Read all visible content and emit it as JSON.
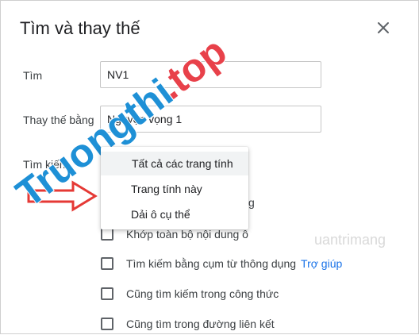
{
  "dialog": {
    "title": "Tìm và thay thế",
    "find_label": "Tìm",
    "find_value": "NV1",
    "replace_label": "Thay thế bằng",
    "replace_value": "Nguyện vọng 1",
    "search_label": "Tìm kiếm"
  },
  "dropdown": {
    "options": [
      "Tất cả các trang tính",
      "Trang tính này",
      "Dải ô cụ thể"
    ],
    "selected": "Tất cả các trang tính"
  },
  "options": {
    "match_case": "g",
    "match_entire": "Khớp toàn bộ nội dung ô",
    "regex": "Tìm kiếm bằng cụm từ thông dụng",
    "help": "Trợ giúp",
    "formulas": "Cũng tìm kiếm trong công thức",
    "links": "Cũng tìm trong đường liên kết"
  },
  "watermark": {
    "text": "Truongthi.top",
    "quantrimang": "uantrimang"
  },
  "colors": {
    "link": "#1a73e8",
    "watermark_blue": "#1e90d6",
    "watermark_red": "#e8414a",
    "arrow_red": "#e53935"
  }
}
